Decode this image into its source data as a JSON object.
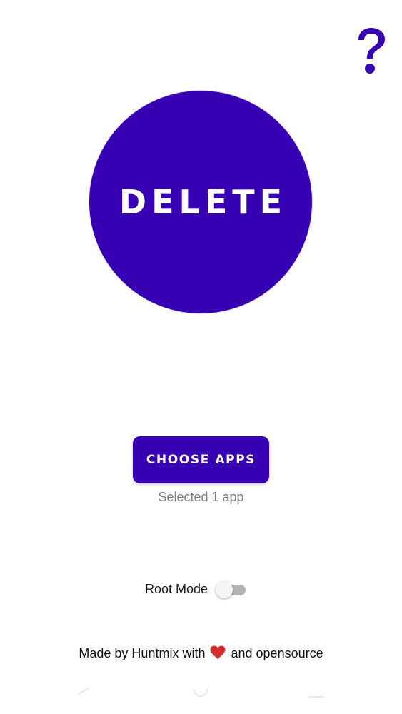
{
  "colors": {
    "primary": "#3700b3",
    "background": "#ffffff",
    "secondary_text": "#7a7a7a",
    "heart": "#d32f2f"
  },
  "header": {
    "help_icon": "question-mark-icon"
  },
  "main": {
    "delete_label": "DELETE"
  },
  "apps": {
    "choose_label": "CHOOSE APPS",
    "selected_text": "Selected 1 app"
  },
  "root_mode": {
    "label": "Root Mode",
    "enabled": false
  },
  "footer": {
    "prefix": "Made by Huntmix with",
    "icon": "heart-icon",
    "suffix": "and opensource"
  },
  "navigation": {
    "icons": [
      "back-icon",
      "home-icon",
      "recent-apps-icon"
    ]
  }
}
